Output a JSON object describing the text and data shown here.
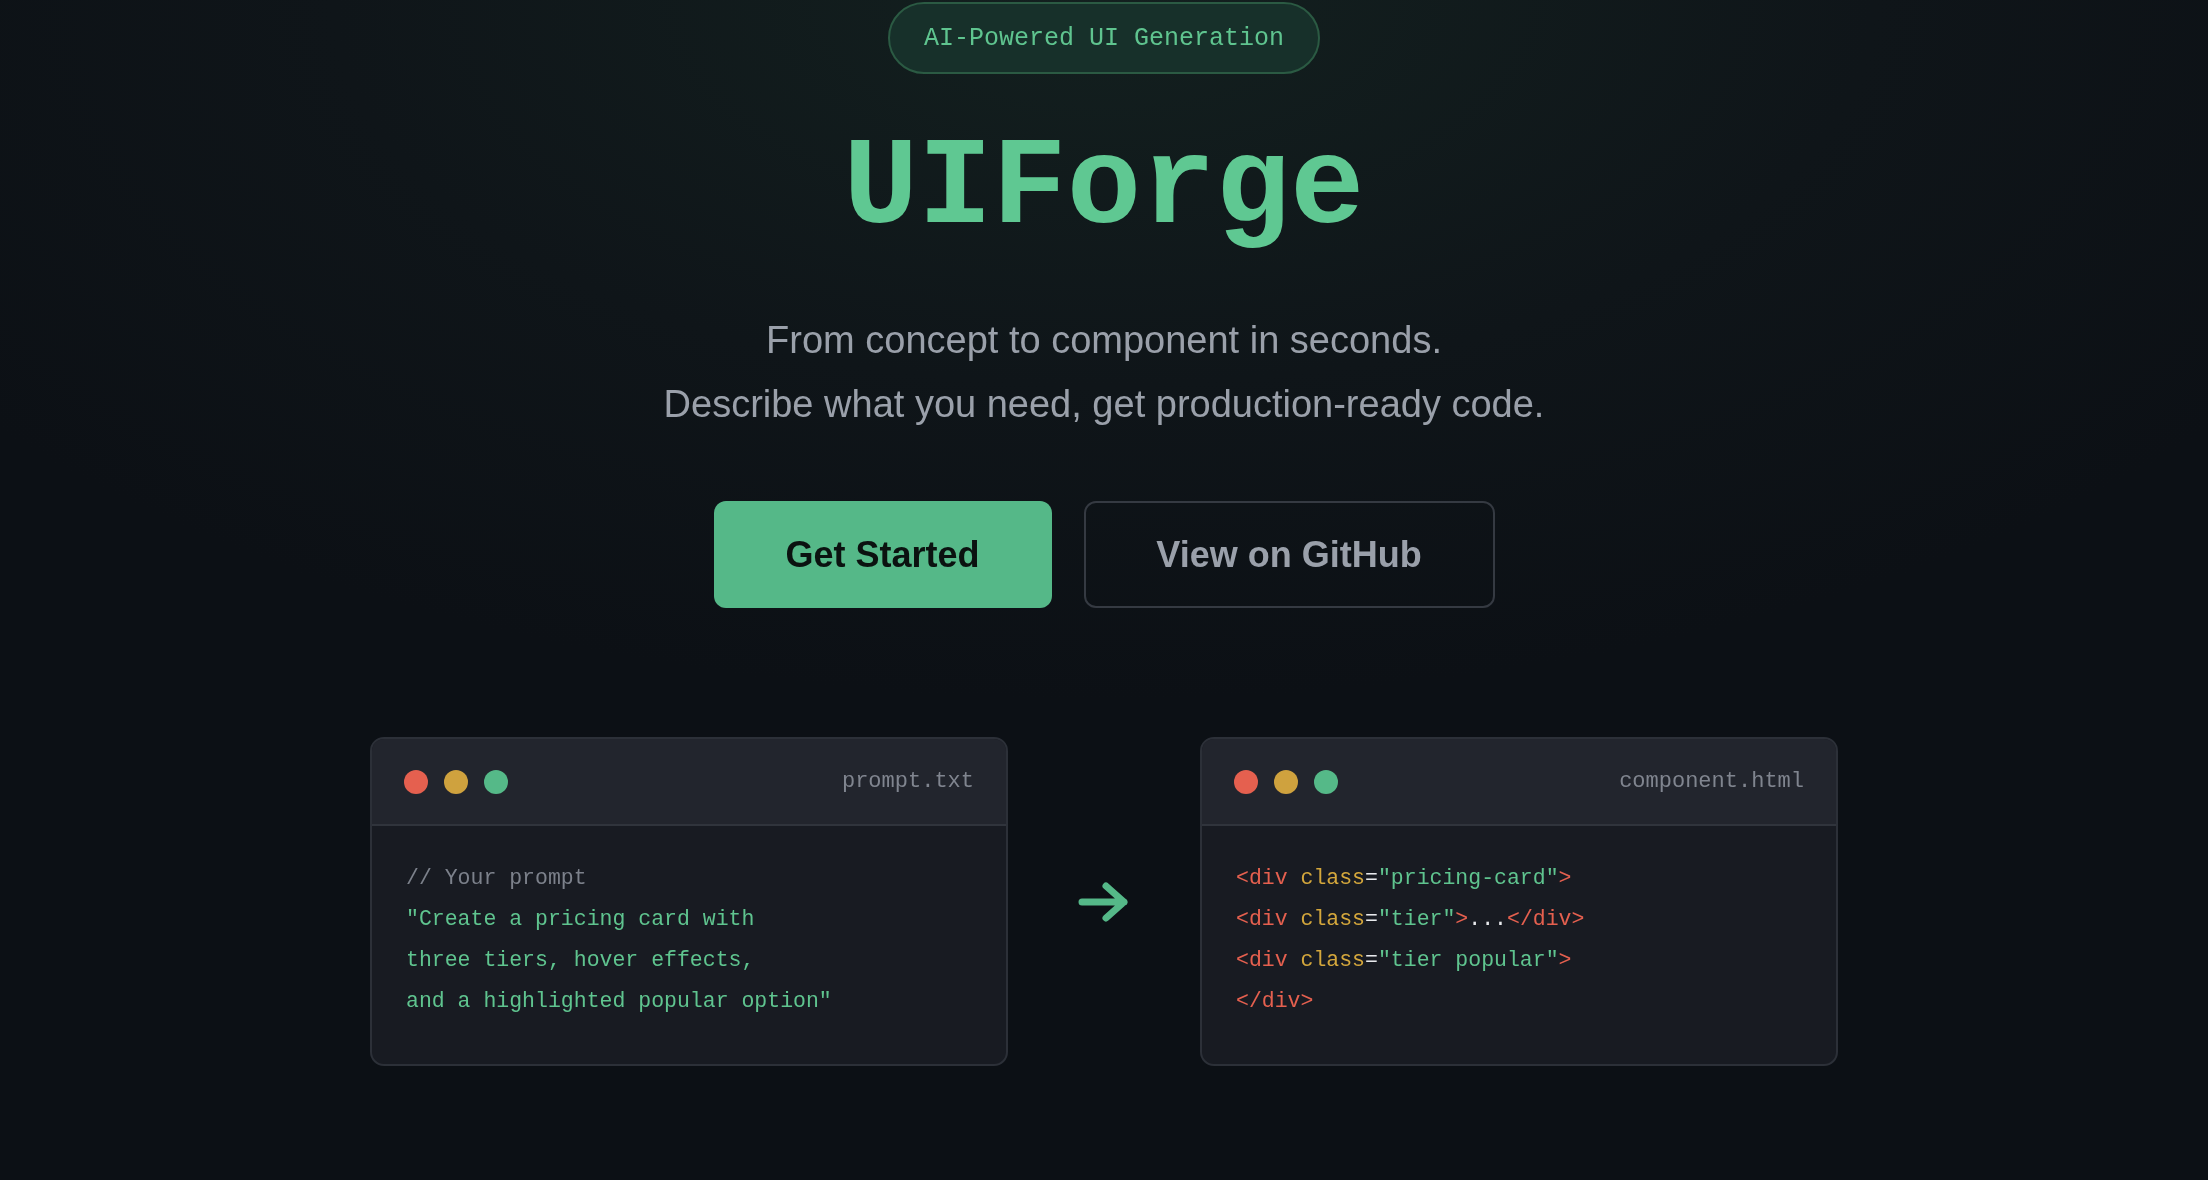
{
  "badge": "AI-Powered UI Generation",
  "title": "UIForge",
  "subtitle": [
    "From concept to component in seconds.",
    "Describe what you need, get production-ready code."
  ],
  "buttons": [
    {
      "label": "Get Started",
      "kind": "primary"
    },
    {
      "label": "View on GitHub",
      "kind": "secondary"
    }
  ],
  "windows": [
    {
      "filename": "prompt.txt",
      "dots": [
        {
          "color": "#e5604f"
        },
        {
          "color": "#cfa23e"
        },
        {
          "color": "#55b988"
        }
      ],
      "lines": [
        [
          {
            "kind": "comment",
            "text": "// Your prompt"
          }
        ],
        [
          {
            "kind": "string",
            "text": "\"Create a pricing card with"
          }
        ],
        [
          {
            "kind": "string",
            "text": "three tiers, hover effects,"
          }
        ],
        [
          {
            "kind": "string",
            "text": "and a highlighted popular option\""
          }
        ]
      ]
    },
    {
      "filename": "component.html",
      "dots": [
        {
          "color": "#e5604f"
        },
        {
          "color": "#cfa23e"
        },
        {
          "color": "#55b988"
        }
      ],
      "lines": [
        [
          {
            "kind": "tag",
            "text": "<div "
          },
          {
            "kind": "attr",
            "text": "class"
          },
          {
            "kind": "punct",
            "text": "="
          },
          {
            "kind": "string",
            "text": "\"pricing-card\""
          },
          {
            "kind": "tag",
            "text": ">"
          }
        ],
        [
          {
            "kind": "tag",
            "text": "<div "
          },
          {
            "kind": "attr",
            "text": "class"
          },
          {
            "kind": "punct",
            "text": "="
          },
          {
            "kind": "string",
            "text": "\"tier\""
          },
          {
            "kind": "tag",
            "text": ">"
          },
          {
            "kind": "punct",
            "text": "..."
          },
          {
            "kind": "tag",
            "text": "</div>"
          }
        ],
        [
          {
            "kind": "tag",
            "text": "<div "
          },
          {
            "kind": "attr",
            "text": "class"
          },
          {
            "kind": "punct",
            "text": "="
          },
          {
            "kind": "string",
            "text": "\"tier popular\""
          },
          {
            "kind": "tag",
            "text": ">"
          }
        ],
        [
          {
            "kind": "tag",
            "text": "</div>"
          }
        ]
      ]
    }
  ]
}
